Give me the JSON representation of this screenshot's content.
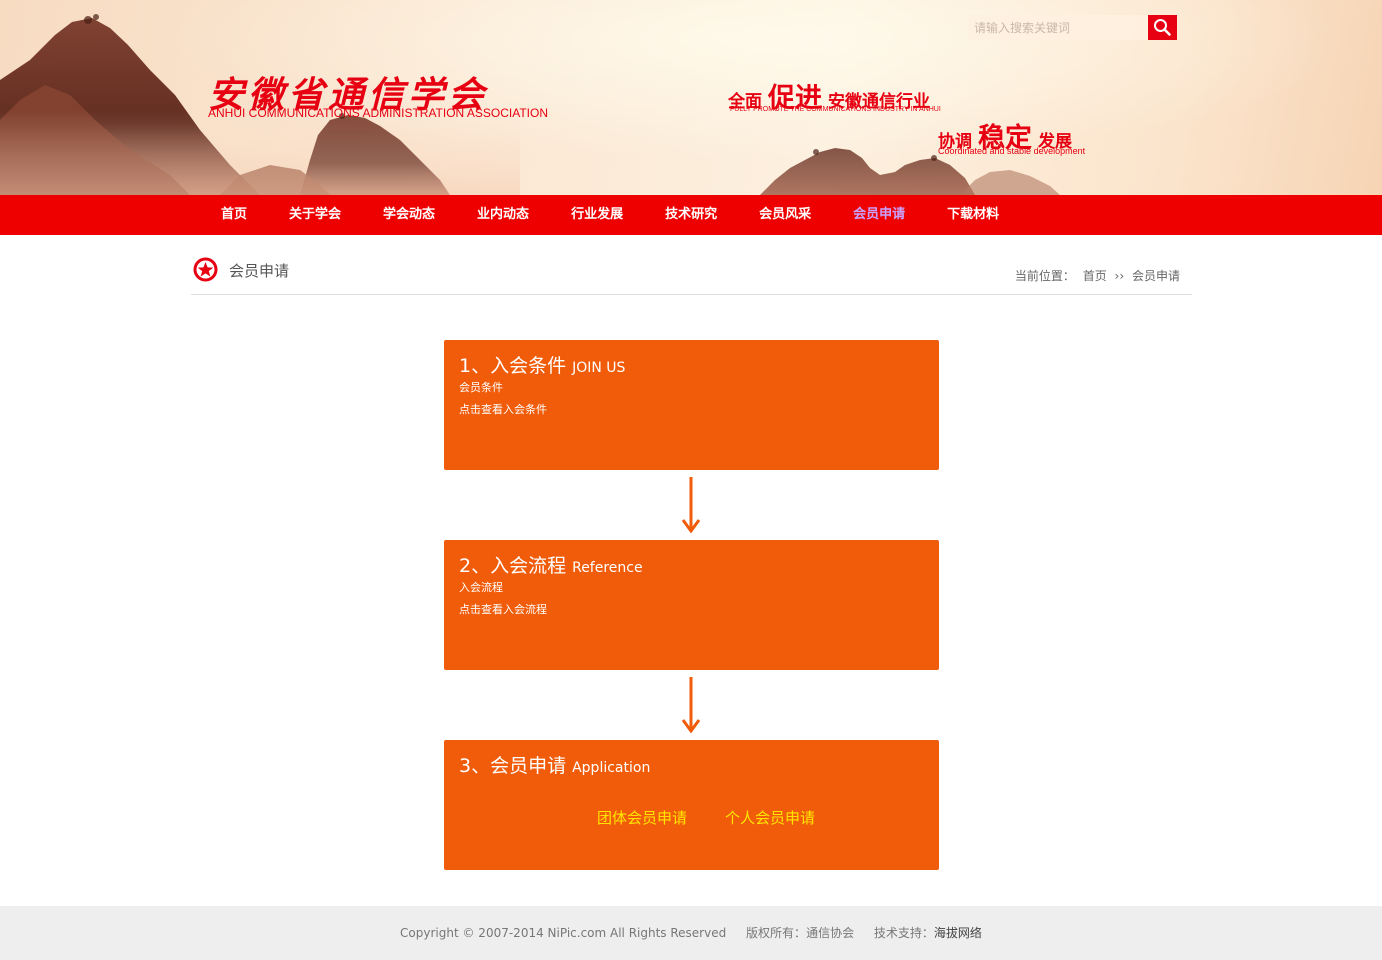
{
  "header": {
    "logo_cn": "安徽省通信学会",
    "logo_en": "ANHUI COMMUNICATIONS ADMINISTRATION ASSOCIATION",
    "slogan1": {
      "pre": "全面",
      "big": "促进",
      "post": "安徽通信行业",
      "en": "FULLY PROMOTE THE COMMUNICATIONS INDUSTRY IN ANHUI"
    },
    "slogan2": {
      "pre": "协调",
      "big": "稳定",
      "post": "发展",
      "en": "Coordinated and stable development"
    },
    "search": {
      "placeholder": "请输入搜索关键词"
    }
  },
  "nav": {
    "items": [
      "首页",
      "关于学会",
      "学会动态",
      "业内动态",
      "行业发展",
      "技术研究",
      "会员风采",
      "会员申请",
      "下载材料"
    ],
    "active": "会员申请"
  },
  "page": {
    "title": "会员申请",
    "breadcrumb": {
      "label": "当前位置：",
      "home": "首页",
      "sep": "››",
      "current": "会员申请"
    }
  },
  "steps": [
    {
      "title": "1、入会条件",
      "en": "JOIN US",
      "line1": "会员条件",
      "line2": "点击查看入会条件"
    },
    {
      "title": "2、入会流程",
      "en": "Reference",
      "line1": "入会流程",
      "line2": "点击查看入会流程"
    },
    {
      "title": "3、会员申请",
      "en": "Application",
      "links": [
        "团体会员申请",
        "个人会员申请"
      ]
    }
  ],
  "footer": {
    "copyright": "Copyright © 2007-2014 NiPic.com All Rights Reserved",
    "owner_label": "版权所有：",
    "owner": "通信协会",
    "support_label": "技术支持：",
    "support": "海拔网络"
  },
  "colors": {
    "brand_red": "#ee0000",
    "step_orange": "#f05c0a",
    "link_yellow": "#ffe500",
    "nav_active": "#c9a2ff"
  },
  "icons": {
    "search": "search-icon",
    "title": "star-badge-icon",
    "arrow": "arrow-down-icon"
  }
}
